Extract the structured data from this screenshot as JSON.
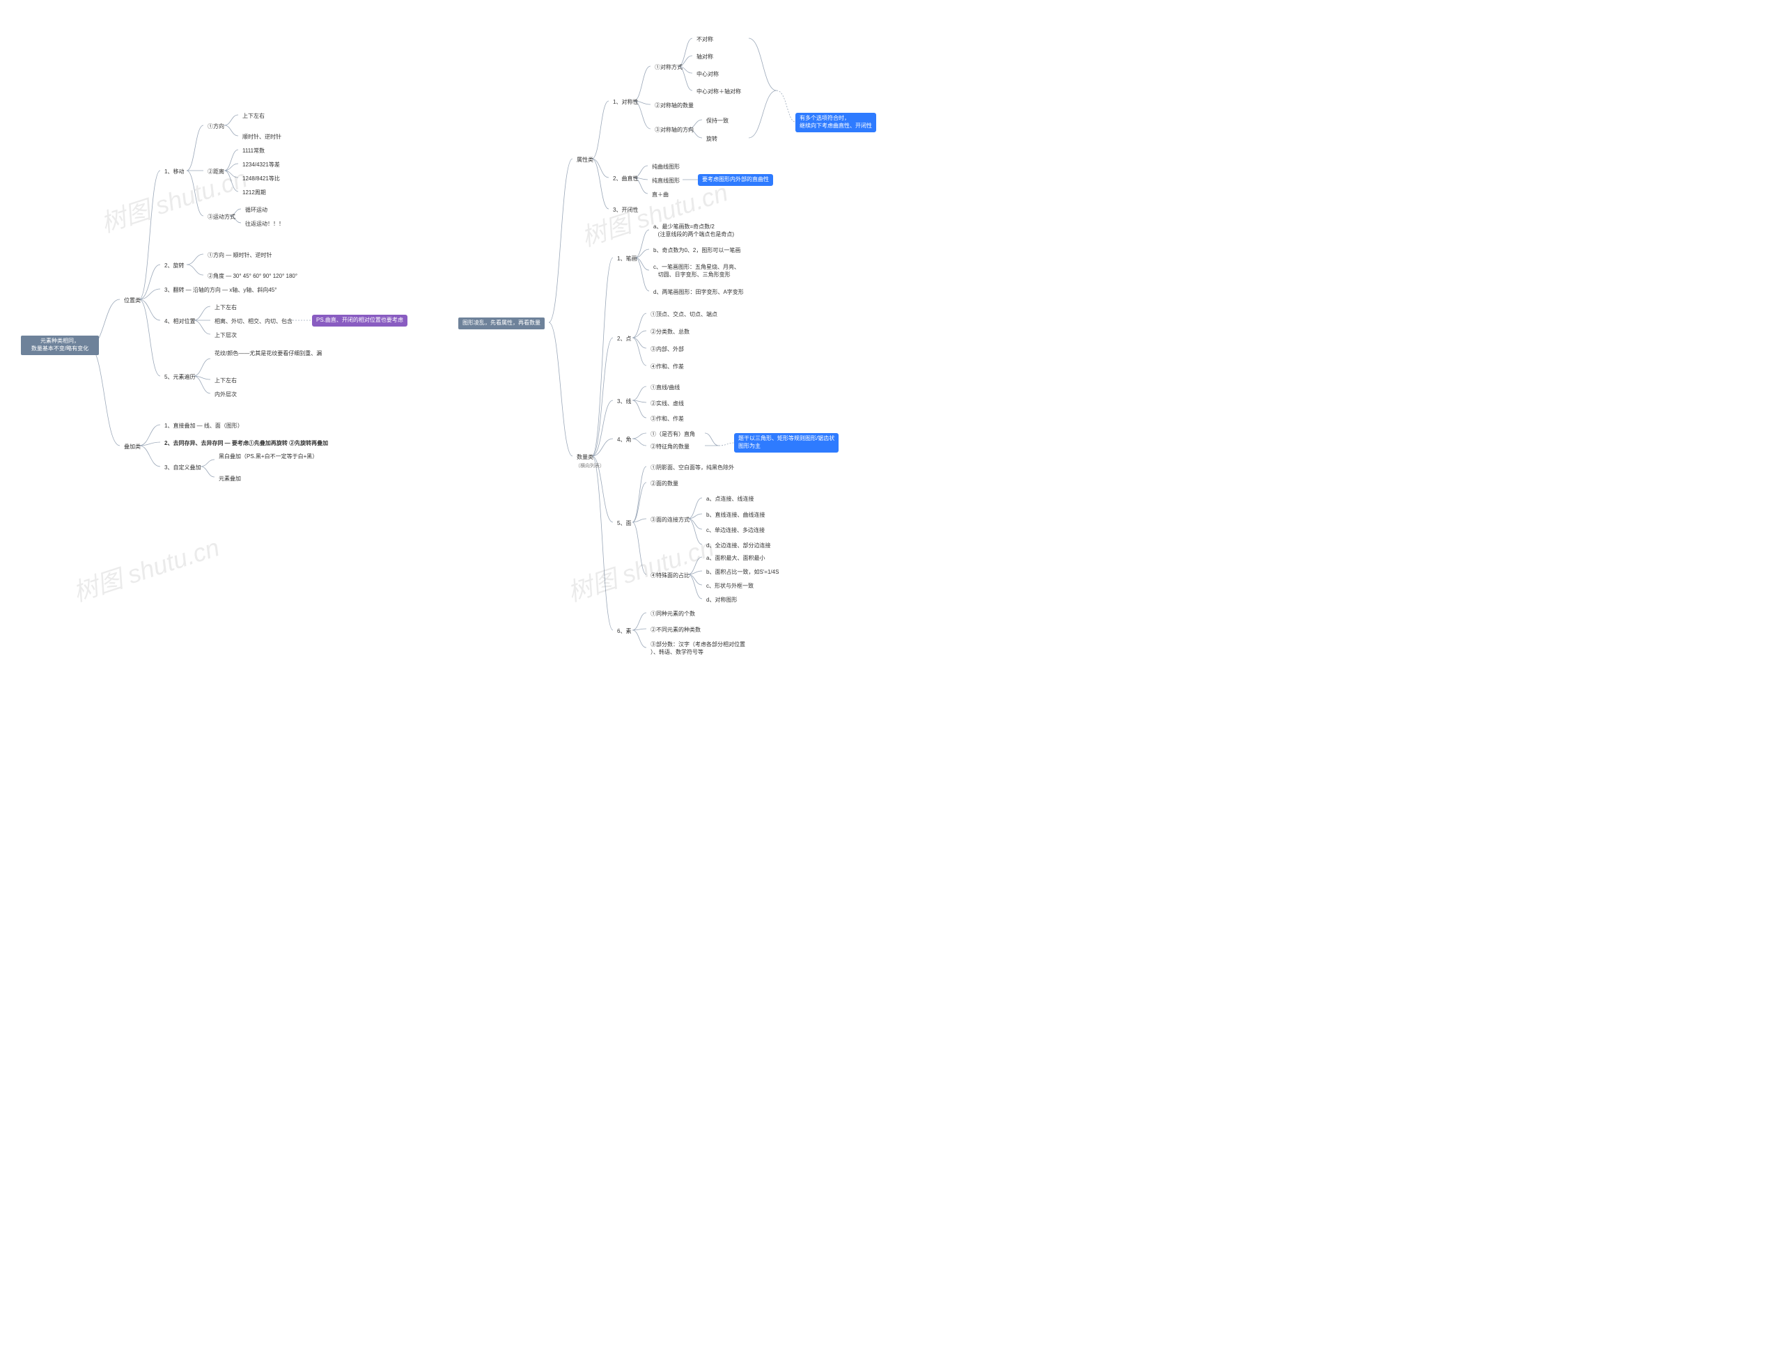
{
  "leftRoot": {
    "l1": "元素种类相同，",
    "l2": "数量基本不变/略有变化"
  },
  "leftCat": {
    "pos": "位置类",
    "add": "叠加类"
  },
  "pos": {
    "l1": "1、移动",
    "l2": "2、旋转",
    "l3": "3、翻转 — 沿轴的方向 — x轴、y轴、斜向45°",
    "l4": "4、相对位置",
    "l5": "5、元素遍历",
    "m1a": "①方向",
    "m1b": "②距离",
    "m1c": "③运动方式",
    "m2a": "①方向 — 顺时针、逆时针",
    "m2b": "②角度 — 30° 45° 60° 90° 120° 180°",
    "r1": "上下左右",
    "r2": "顺时针、逆时针",
    "r3": "1111常数",
    "r4": "1234/4321等差",
    "r5": "1248/8421等比",
    "r6": "1212周期",
    "r7": "循环运动",
    "r8": "往返运动！！！",
    "r9": "上下左右",
    "r10": "相离、外切、相交、内切、包含",
    "r11": "上下层次",
    "r12": "花纹/颜色——尤其是花纹要看仔细别重、漏",
    "r13": "上下左右",
    "r14": "内外层次"
  },
  "purpleNote": "PS.曲直、开闭的相对位置也要考虑",
  "add": {
    "a1": "1、直接叠加 — 线、面（图形）",
    "a2": "2、去同存异、去异存同 — 要考虑①先叠加再旋转 ②先旋转再叠加",
    "a3": "3、自定义叠加",
    "a3a": "黑白叠加（PS.黑+白不一定等于白+黑）",
    "a3b": "元素叠加"
  },
  "center": "图形凌乱，先看属性，再看数量",
  "rightCat": {
    "attr": "属性类",
    "num": "数量类",
    "numSub": "（横向列表）"
  },
  "attr": {
    "a1": "1、对称性",
    "a2": "2、曲直性",
    "a3": "3、开闭性",
    "m1": "①对称方式",
    "m2": "②对称轴的数量",
    "m3": "③对称轴的方向",
    "r1": "不对称",
    "r2": "轴对称",
    "r3": "中心对称",
    "r4": "中心对称＋轴对称",
    "r5": "保持一致",
    "r6": "旋转",
    "b1": "纯曲线图形",
    "b2": "纯直线图形",
    "b3": "直＋曲"
  },
  "note1": "有多个选项符合时，\n继续向下考虑曲直性、开闭性",
  "note2": "要考虑图形内外部的直曲性",
  "note3": "题干以三角形、矩形等规则图形/锯齿状\n图形为主",
  "num": {
    "n1": "1、笔画",
    "n2": "2、点",
    "n3": "3、线",
    "n4": "4、角",
    "n5": "5、面",
    "n6": "6、素",
    "p1a": "a、最少笔画数=奇点数/2\n   (注意线段的两个端点也是奇点)",
    "p1b": "b、奇点数为0、2，图形可以一笔画",
    "p1c": "c、一笔画图形：五角星烧、月亮、\n   切圆、日字变形、三角形变形",
    "p1d": "d、两笔画图形：田字变形、A字变形",
    "p2a": "①顶点、交点、切点、端点",
    "p2b": "②分类数、总数",
    "p2c": "③内部、外部",
    "p2d": "④作和、作差",
    "p3a": "①直线/曲线",
    "p3b": "②实线、虚线",
    "p3c": "③作和、作差",
    "p4a": "①（是否有）直角",
    "p4b": "②特征角的数量",
    "p5a": "①阴影面、空白面等，纯黑色除外",
    "p5b": "②面的数量",
    "p5c": "③面的连接方式",
    "p5d": "④特殊面的占比",
    "p5ca": "a、点连接、线连接",
    "p5cb": "b、直线连接、曲线连接",
    "p5cc": "c、单边连接、多边连接",
    "p5cd": "d、全边连接、部分边连接",
    "p5da": "a、面积最大、面积最小",
    "p5db": "b、面积占比一致，如S'=1/4S",
    "p5dc": "c、形状与外框一致",
    "p5dd": "d、对称图形",
    "p6a": "①同种元素的个数",
    "p6b": "②不同元素的种类数",
    "p6c": "③部分数：汉字（考虑各部分相对位置\n）、韩语、数学符号等"
  },
  "wm": "树图 shutu.cn"
}
